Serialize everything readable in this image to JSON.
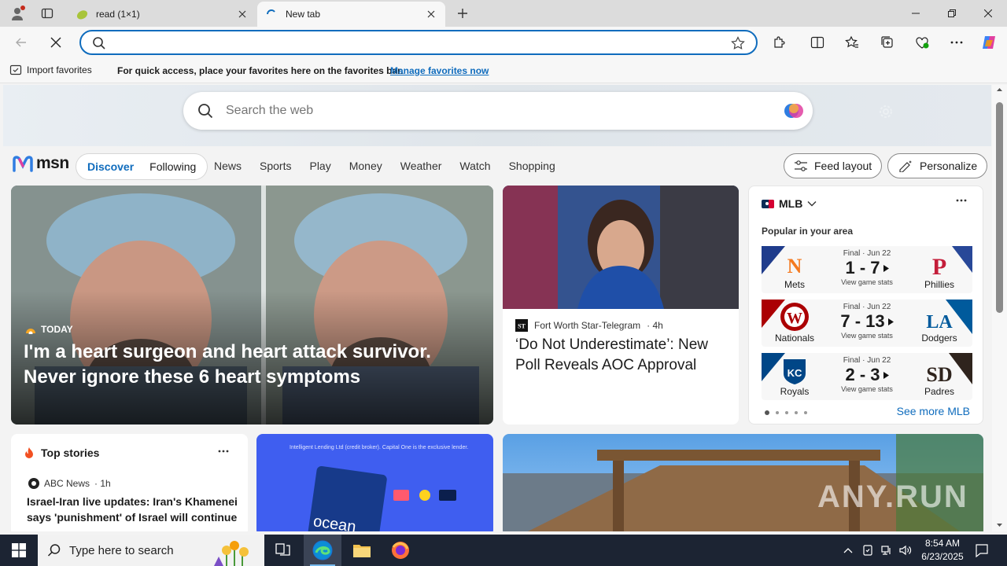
{
  "browser": {
    "tabs": [
      {
        "title": "read (1×1)",
        "active": false
      },
      {
        "title": "New tab",
        "active": true
      }
    ],
    "address": {
      "value": "",
      "placeholder": ""
    },
    "favorites_bar": {
      "import_label": "Import favorites",
      "message": "For quick access, place your favorites here on the favorites bar.",
      "link": "Manage favorites now"
    }
  },
  "msn": {
    "search_placeholder": "Search the web",
    "logo": "msn",
    "pills": [
      "Discover",
      "Following"
    ],
    "nav": [
      "News",
      "Sports",
      "Play",
      "Money",
      "Weather",
      "Watch",
      "Shopping"
    ],
    "feed_layout": "Feed layout",
    "personalize": "Personalize",
    "hero": {
      "source": "TODAY",
      "headline": "I'm a heart surgeon and heart attack survivor. Never ignore these 6 heart symptoms"
    },
    "aoc": {
      "source": "Fort Worth Star-Telegram",
      "source_logo": "ST",
      "age": "· 4h",
      "headline": "‘Do Not Underestimate’: New Poll Reveals AOC Approval"
    },
    "mlb": {
      "title": "MLB",
      "subtitle": "Popular in your area",
      "see_more": "See more MLB",
      "games": [
        {
          "status": "Final · Jun 22",
          "score": "1 - 7",
          "stats": "View game stats",
          "left": "Mets",
          "right": "Phillies"
        },
        {
          "status": "Final · Jun 22",
          "score": "7 - 13",
          "stats": "View game stats",
          "left": "Nationals",
          "right": "Dodgers"
        },
        {
          "status": "Final · Jun 22",
          "score": "2 - 3",
          "stats": "View game stats",
          "left": "Royals",
          "right": "Padres"
        }
      ]
    },
    "top_stories": {
      "title": "Top stories",
      "source": "ABC News",
      "age": "· 1h",
      "headline": "Israel-Iran live updates: Iran's Khamenei says 'punishment' of Israel will continue"
    },
    "ad": {
      "disclaimer": "Intelligent Lending Ltd (credit broker). Capital One is the exclusive lender.",
      "card_text": "ocean"
    },
    "watermark": "ANY.RUN"
  },
  "taskbar": {
    "search_placeholder": "Type here to search",
    "time": "8:54 AM",
    "date": "6/23/2025"
  },
  "colors": {
    "accent": "#0f6cbd",
    "taskbar": "#1c2433"
  }
}
